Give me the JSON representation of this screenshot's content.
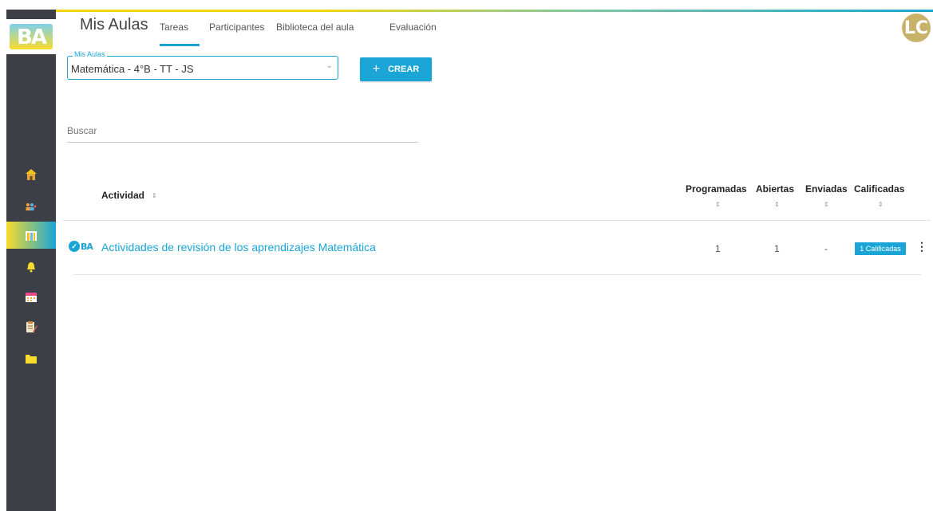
{
  "header": {
    "title": "Mis Aulas",
    "tabs": [
      "Tareas",
      "Participantes",
      "Biblioteca del aula",
      "Evaluación"
    ],
    "active_tab": "Tareas",
    "avatar_initials": "LC"
  },
  "logo_text": "BA",
  "sidebar": {
    "icons": [
      "school-icon",
      "people-icon",
      "classroom-icon",
      "bell-icon",
      "calendar-icon",
      "assignment-icon",
      "folder-icon"
    ],
    "active": "classroom-icon"
  },
  "aula_select": {
    "legend": "Mis Aulas",
    "value": "Matemática - 4°B - TT - JS"
  },
  "crear_button": {
    "plus": "+",
    "label": "CREAR"
  },
  "search": {
    "placeholder": "Buscar"
  },
  "table": {
    "columns": [
      "Actividad",
      "Programadas",
      "Abiertas",
      "Enviadas",
      "Calificadas"
    ],
    "rows": [
      {
        "badge": "BA",
        "actividad": "Actividades de revisión de los aprendizajes Matemática",
        "programadas": "1",
        "abiertas": "1",
        "enviadas": "-",
        "calificadas": "1 Calificadas"
      }
    ]
  },
  "colors": {
    "accent": "#1aa5d6",
    "sidebar": "#3c3f45",
    "yellow": "#f8dc2b"
  }
}
